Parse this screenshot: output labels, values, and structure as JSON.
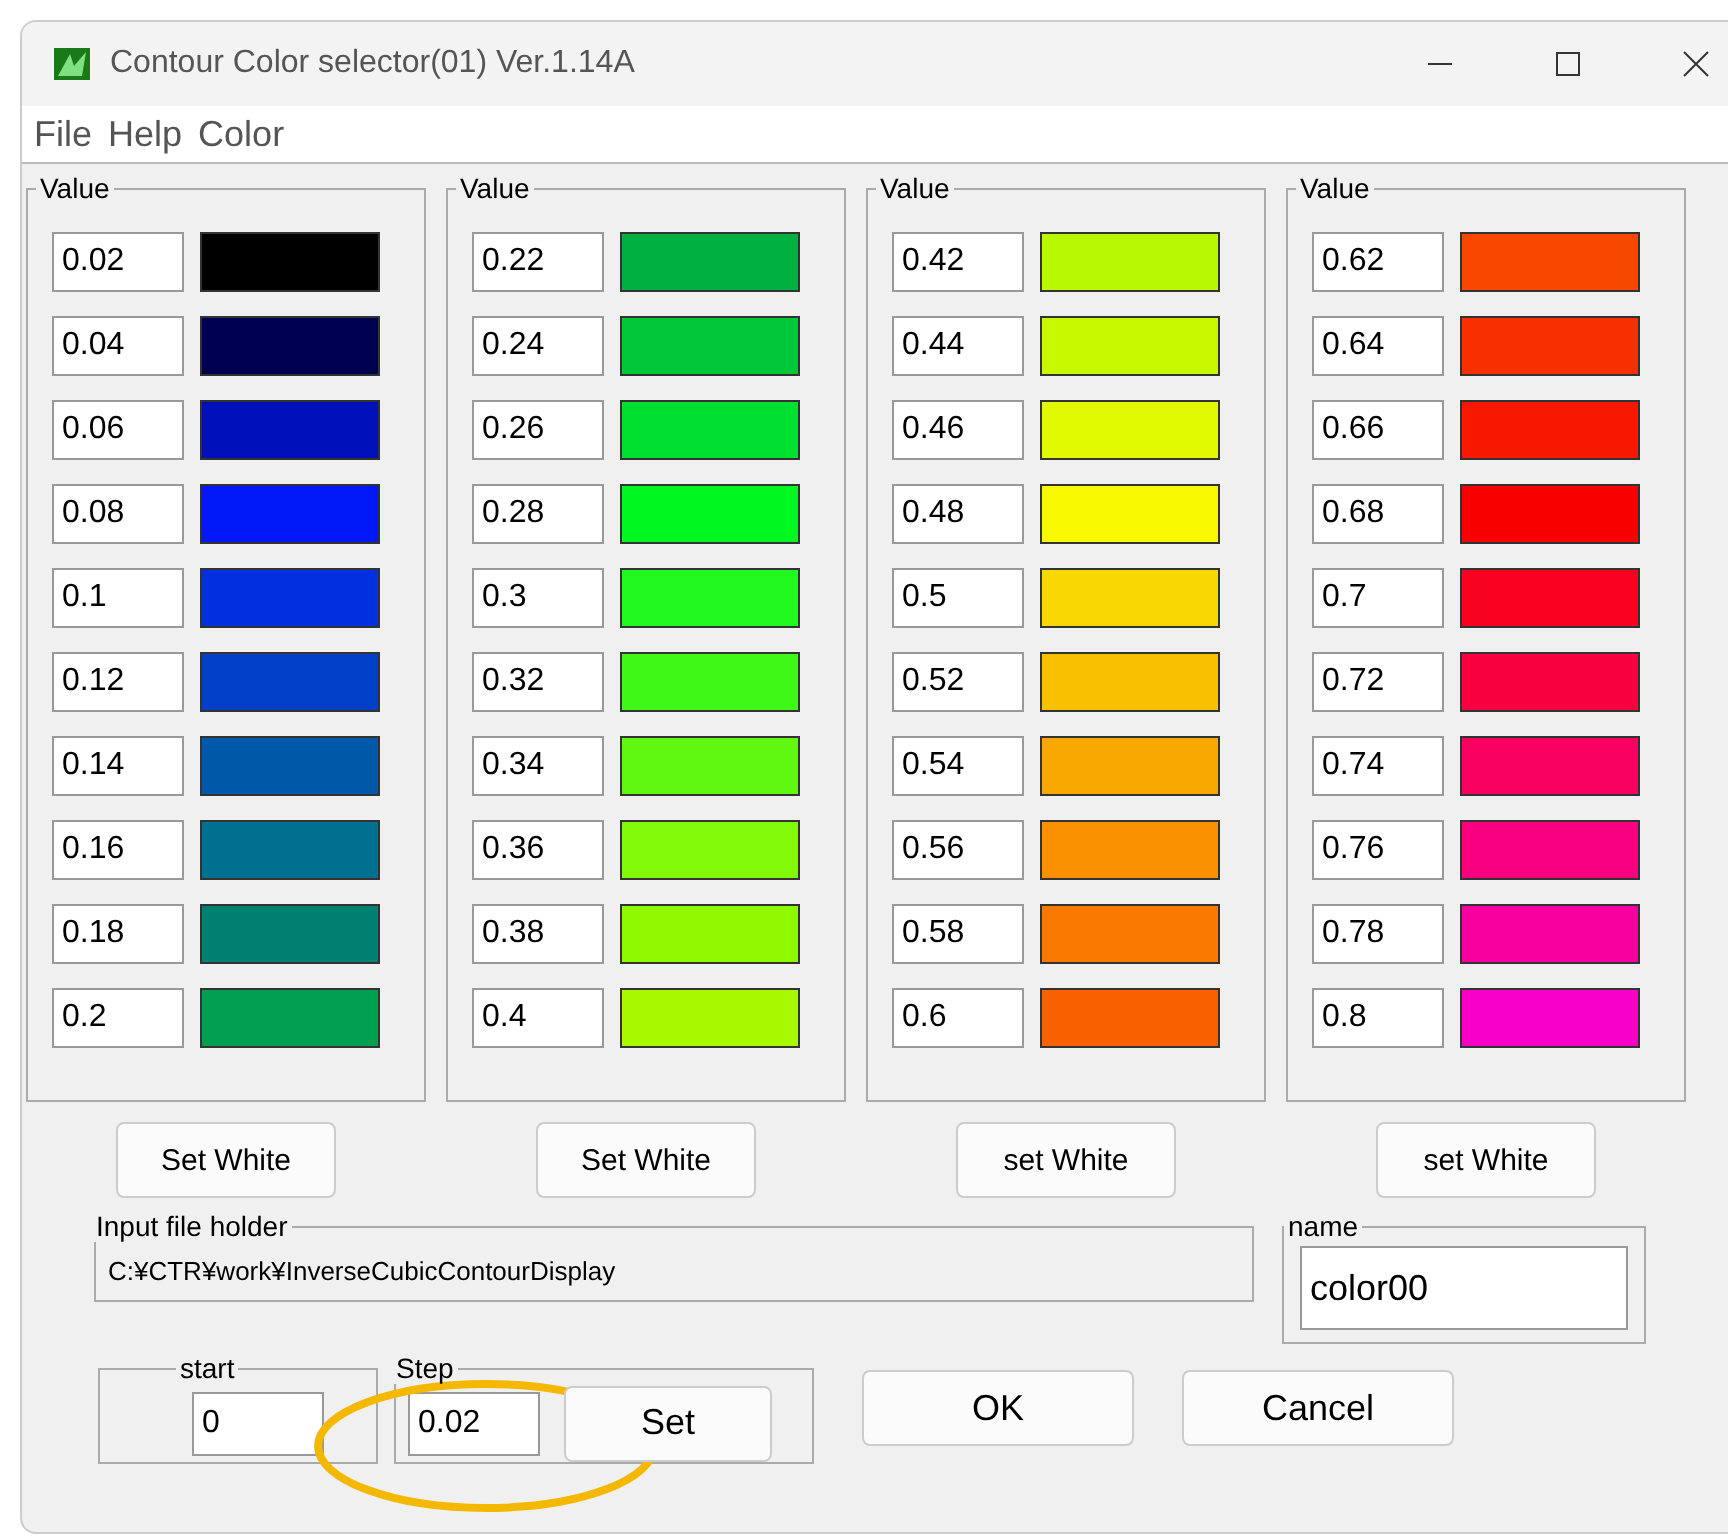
{
  "window": {
    "title": "Contour Color selector(01) Ver.1.14A"
  },
  "menu": [
    "File",
    "Help",
    "Color"
  ],
  "groups": [
    {
      "label": "Value",
      "button": "Set White",
      "rows": [
        {
          "value": "0.02",
          "color": "#000000"
        },
        {
          "value": "0.04",
          "color": "#000050"
        },
        {
          "value": "0.06",
          "color": "#0010b8"
        },
        {
          "value": "0.08",
          "color": "#0018f8"
        },
        {
          "value": "0.1",
          "color": "#0030e0"
        },
        {
          "value": "0.12",
          "color": "#0040c8"
        },
        {
          "value": "0.14",
          "color": "#0058a8"
        },
        {
          "value": "0.16",
          "color": "#007090"
        },
        {
          "value": "0.18",
          "color": "#008070"
        },
        {
          "value": "0.2",
          "color": "#00a050"
        }
      ]
    },
    {
      "label": "Value",
      "button": "Set White",
      "rows": [
        {
          "value": "0.22",
          "color": "#00b040"
        },
        {
          "value": "0.24",
          "color": "#00c838"
        },
        {
          "value": "0.26",
          "color": "#00e030"
        },
        {
          "value": "0.28",
          "color": "#00f820"
        },
        {
          "value": "0.3",
          "color": "#20f820"
        },
        {
          "value": "0.32",
          "color": "#40f818"
        },
        {
          "value": "0.34",
          "color": "#60f810"
        },
        {
          "value": "0.36",
          "color": "#80f808"
        },
        {
          "value": "0.38",
          "color": "#90f800"
        },
        {
          "value": "0.4",
          "color": "#a8f800"
        }
      ]
    },
    {
      "label": "Value",
      "button": "set White",
      "rows": [
        {
          "value": "0.42",
          "color": "#b8f800"
        },
        {
          "value": "0.44",
          "color": "#c8f800"
        },
        {
          "value": "0.46",
          "color": "#e0f800"
        },
        {
          "value": "0.48",
          "color": "#f8f800"
        },
        {
          "value": "0.5",
          "color": "#f8d800"
        },
        {
          "value": "0.52",
          "color": "#f8c000"
        },
        {
          "value": "0.54",
          "color": "#f8a800"
        },
        {
          "value": "0.56",
          "color": "#f89000"
        },
        {
          "value": "0.58",
          "color": "#f87800"
        },
        {
          "value": "0.6",
          "color": "#f86000"
        }
      ]
    },
    {
      "label": "Value",
      "button": "set White",
      "rows": [
        {
          "value": "0.62",
          "color": "#f84800"
        },
        {
          "value": "0.64",
          "color": "#f83000"
        },
        {
          "value": "0.66",
          "color": "#f81800"
        },
        {
          "value": "0.68",
          "color": "#f80000"
        },
        {
          "value": "0.7",
          "color": "#f80020"
        },
        {
          "value": "0.72",
          "color": "#f80040"
        },
        {
          "value": "0.74",
          "color": "#f80060"
        },
        {
          "value": "0.76",
          "color": "#f80080"
        },
        {
          "value": "0.78",
          "color": "#f800a0"
        },
        {
          "value": "0.8",
          "color": "#f800c8"
        }
      ]
    }
  ],
  "input_file": {
    "label": "Input file holder",
    "path": "C:¥CTR¥work¥InverseCubicContourDisplay"
  },
  "name": {
    "label": "name",
    "value": "color00"
  },
  "start": {
    "label": "start",
    "value": "0"
  },
  "step": {
    "label": "Step",
    "value": "0.02",
    "button": "Set"
  },
  "buttons": [
    "OK",
    "Cancel"
  ]
}
